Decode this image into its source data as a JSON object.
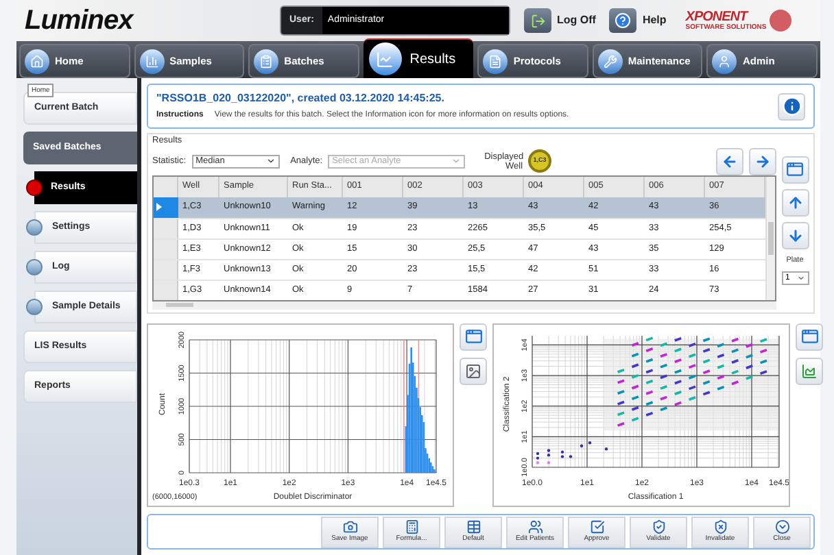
{
  "header": {
    "logo": "Luminex",
    "user_label": "User:",
    "user_name": "Administrator",
    "log_off": "Log Off",
    "help": "Help",
    "brand": "XPONENT",
    "brand_sub": "SOFTWARE SOLUTIONS"
  },
  "tabs": [
    {
      "label": "Home",
      "selected": false
    },
    {
      "label": "Samples",
      "selected": false
    },
    {
      "label": "Batches",
      "selected": false
    },
    {
      "label": "Results",
      "selected": true
    },
    {
      "label": "Protocols",
      "selected": false
    },
    {
      "label": "Maintenance",
      "selected": false
    },
    {
      "label": "Admin",
      "selected": false
    }
  ],
  "tooltip": "Home",
  "sidebar": {
    "items": [
      {
        "label": "Current Batch",
        "selected": false
      },
      {
        "label": "Saved Batches",
        "selected": true,
        "children": [
          {
            "label": "Results",
            "selected": true
          },
          {
            "label": "Settings",
            "selected": false
          },
          {
            "label": "Log",
            "selected": false
          },
          {
            "label": "Sample Details",
            "selected": false
          }
        ]
      },
      {
        "label": "LIS Results",
        "selected": false
      },
      {
        "label": "Reports",
        "selected": false
      }
    ]
  },
  "batch_title": "\"RSSO1B_020_03122020\", created 03.12.2020 14:45:25.",
  "instructions": {
    "label": "Instructions",
    "text": "View the results for this batch. Select the Information icon for more information on results options."
  },
  "results": {
    "label": "Results",
    "statistic_label": "Statistic:",
    "statistic": "Median",
    "analyte_label": "Analyte:",
    "analyte_placeholder": "Select an Analyte",
    "displayed_well_label": "Displayed Well",
    "displayed_well": "1,C3",
    "plate_label": "Plate",
    "plate": "1"
  },
  "table": {
    "columns": [
      "Well",
      "Sample",
      "Run Sta...",
      "001",
      "002",
      "003",
      "004",
      "005",
      "006",
      "007"
    ],
    "rows": [
      {
        "selected": true,
        "cells": [
          "1,C3",
          "Unknown10",
          "Warning",
          "12",
          "39",
          "13",
          "43",
          "42",
          "43",
          "36"
        ]
      },
      {
        "selected": false,
        "cells": [
          "1,D3",
          "Unknown11",
          "Ok",
          "19",
          "23",
          "2265",
          "35,5",
          "45",
          "33",
          "254,5"
        ]
      },
      {
        "selected": false,
        "cells": [
          "1,E3",
          "Unknown12",
          "Ok",
          "15",
          "30",
          "25,5",
          "47",
          "43",
          "35",
          "129"
        ]
      },
      {
        "selected": false,
        "cells": [
          "1,F3",
          "Unknown13",
          "Ok",
          "20",
          "23",
          "15,5",
          "42",
          "51",
          "33",
          "16"
        ]
      },
      {
        "selected": false,
        "cells": [
          "1,G3",
          "Unknown14",
          "Ok",
          "9",
          "7",
          "1584",
          "27",
          "31",
          "24",
          "73"
        ]
      }
    ]
  },
  "histogram": {
    "ylabel": "Count",
    "xlabel": "Doublet Discriminator",
    "range": "(6000,16000)",
    "x_tick_labels": [
      "1e0.3",
      "1e1",
      "1e2",
      "1e3",
      "1e4",
      "1e4.5"
    ],
    "y_tick_labels": [
      "0",
      "500",
      "1000",
      "1500",
      "2000"
    ]
  },
  "scatter": {
    "ylabel": "Classification 2",
    "xlabel": "Classification 1",
    "x_tick_labels": [
      "1e0.0",
      "1e1",
      "1e2",
      "1e3",
      "1e4",
      "1e4.5"
    ],
    "y_tick_labels": [
      "1e0.0",
      "1e1",
      "1e2",
      "1e3",
      "1e4"
    ]
  },
  "buttons": [
    "Save Image",
    "Formula...",
    "Default",
    "Edit Patients",
    "Approve",
    "Validate",
    "Invalidate",
    "Close"
  ]
}
